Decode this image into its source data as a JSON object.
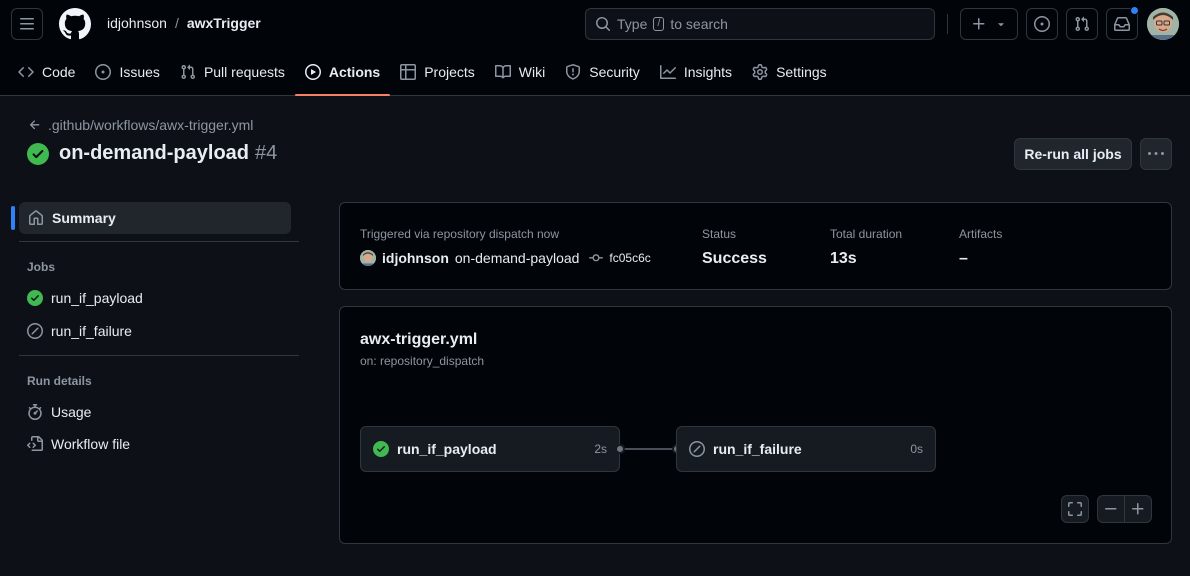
{
  "header": {
    "owner": "idjohnson",
    "separator": "/",
    "repo": "awxTrigger",
    "search_prefix": "Type",
    "search_key": "/",
    "search_suffix": "to search"
  },
  "nav": {
    "code": "Code",
    "issues": "Issues",
    "pull_requests": "Pull requests",
    "actions": "Actions",
    "projects": "Projects",
    "wiki": "Wiki",
    "security": "Security",
    "insights": "Insights",
    "settings": "Settings"
  },
  "run": {
    "workflow_path": ".github/workflows/awx-trigger.yml",
    "title": "on-demand-payload",
    "number": "#4",
    "rerun_label": "Re-run all jobs"
  },
  "sidebar": {
    "summary": "Summary",
    "jobs_heading": "Jobs",
    "jobs": [
      "run_if_payload",
      "run_if_failure"
    ],
    "run_details_heading": "Run details",
    "usage": "Usage",
    "workflow_file": "Workflow file"
  },
  "info": {
    "triggered": "Triggered via repository dispatch now",
    "actor": "idjohnson",
    "event": "on-demand-payload",
    "commit": "fc05c6c",
    "status_label": "Status",
    "status_value": "Success",
    "duration_label": "Total duration",
    "duration_value": "13s",
    "artifacts_label": "Artifacts",
    "artifacts_value": "–"
  },
  "graph": {
    "workflow_file": "awx-trigger.yml",
    "on": "on: repository_dispatch",
    "jobs": [
      {
        "name": "run_if_payload",
        "duration": "2s",
        "status": "success"
      },
      {
        "name": "run_if_failure",
        "duration": "0s",
        "status": "skipped"
      }
    ]
  },
  "colors": {
    "success": "#3fb950",
    "accent": "#f78166",
    "link": "#2f81f7"
  }
}
